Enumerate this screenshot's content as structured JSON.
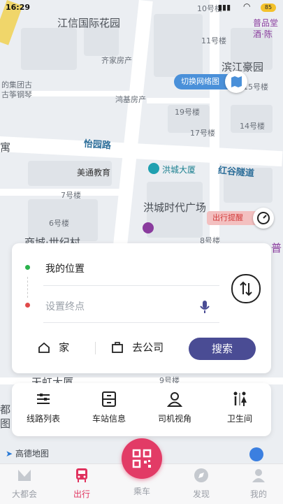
{
  "status_bar": {
    "time": "16:29",
    "battery": "85"
  },
  "map": {
    "labels": {
      "jiangxin": "江信国际花园",
      "qijia": "齐家房产",
      "group": "的集团古",
      "qin": "古筝钢琴",
      "honghai": "鸿基房产",
      "binjiang": "滨江豪园",
      "puping": "普品堂",
      "jiudian": "酒·陈",
      "yiyuan": "怡园路",
      "meitong": "美通教育",
      "hongcheng": "洪城大厦",
      "hongshan": "红谷隧道",
      "hcsd": "洪城时代广场",
      "century": "商城·世纪村",
      "b7": "7号楼",
      "b6": "6号楼",
      "b8": "8号楼",
      "b10": "10号楼",
      "b11": "11号楼",
      "b19": "19号楼",
      "b17": "17号楼",
      "b14": "14号楼",
      "b15": "15号楼",
      "side_yu": "寓",
      "side_du": "都",
      "side_tu": "图",
      "side_pu": "普",
      "tianhong": "天虹大厦",
      "b9": "9号楼"
    },
    "switch_map_label": "切换网络图",
    "alert_label": "出行提醒",
    "provider": "高德地图"
  },
  "route": {
    "origin": "我的位置",
    "destination_placeholder": "设置终点",
    "home_label": "家",
    "company_label": "去公司",
    "search_label": "搜索"
  },
  "shortcuts": [
    {
      "label": "线路列表",
      "icon": "route-list-icon"
    },
    {
      "label": "车站信息",
      "icon": "station-info-icon"
    },
    {
      "label": "司机视角",
      "icon": "driver-view-icon"
    },
    {
      "label": "卫生间",
      "icon": "restroom-icon"
    }
  ],
  "nav": {
    "items": [
      {
        "label": "大都会",
        "active": false
      },
      {
        "label": "出行",
        "active": true
      },
      {
        "label": "乘车",
        "active": false
      },
      {
        "label": "发现",
        "active": false
      },
      {
        "label": "我的",
        "active": false
      }
    ]
  },
  "colors": {
    "accent": "#e23b66",
    "search": "#4a4c94",
    "switch_chip": "#4a90d9"
  }
}
